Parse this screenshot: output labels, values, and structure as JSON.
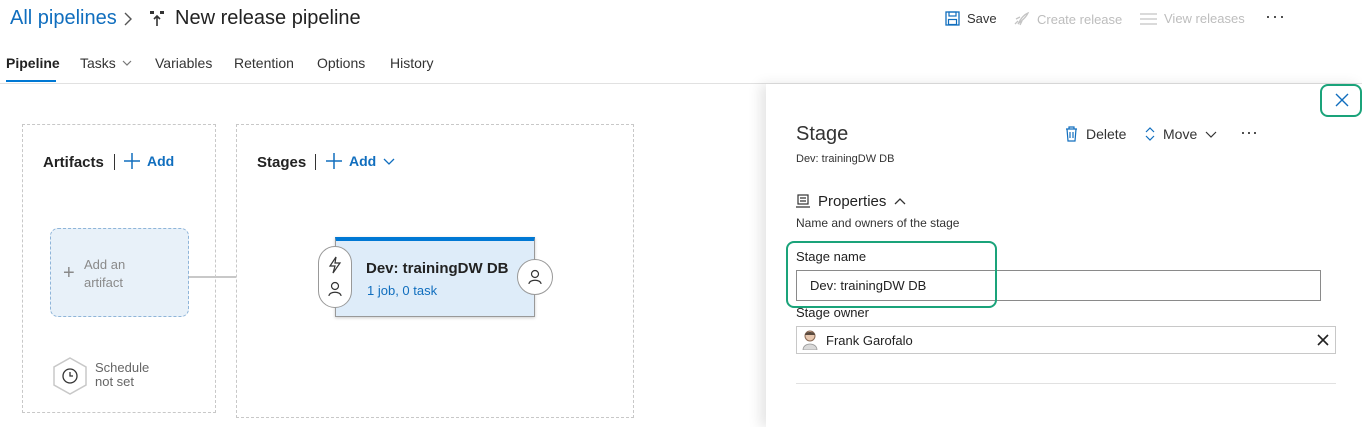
{
  "header": {
    "breadcrumb": "All pipelines",
    "title": "New release pipeline",
    "save_label": "Save",
    "create_release_label": "Create release",
    "view_releases_label": "View releases",
    "more_label": "···"
  },
  "tabs": [
    {
      "label": "Pipeline"
    },
    {
      "label": "Tasks"
    },
    {
      "label": "Variables"
    },
    {
      "label": "Retention"
    },
    {
      "label": "Options"
    },
    {
      "label": "History"
    }
  ],
  "artifacts": {
    "title": "Artifacts",
    "add_label": "Add",
    "placeholder_line1": "Add an",
    "placeholder_line2": "artifact",
    "schedule_line1": "Schedule",
    "schedule_line2": "not set"
  },
  "stages": {
    "title": "Stages",
    "add_label": "Add",
    "card_name": "Dev: trainingDW DB",
    "card_sub": "1 job, 0 task"
  },
  "panel": {
    "title": "Stage",
    "subtitle": "Dev: trainingDW DB",
    "delete_label": "Delete",
    "move_label": "Move",
    "more_label": "···",
    "section_title": "Properties",
    "section_desc": "Name and owners of the stage",
    "stage_name_label": "Stage name",
    "stage_name_value": "Dev: trainingDW DB",
    "stage_owner_label": "Stage owner",
    "stage_owner_value": "Frank Garofalo"
  },
  "colors": {
    "accent": "#0078d4",
    "link": "#106ebe",
    "highlight": "#1aa37a",
    "card_bg": "#deecf9"
  }
}
